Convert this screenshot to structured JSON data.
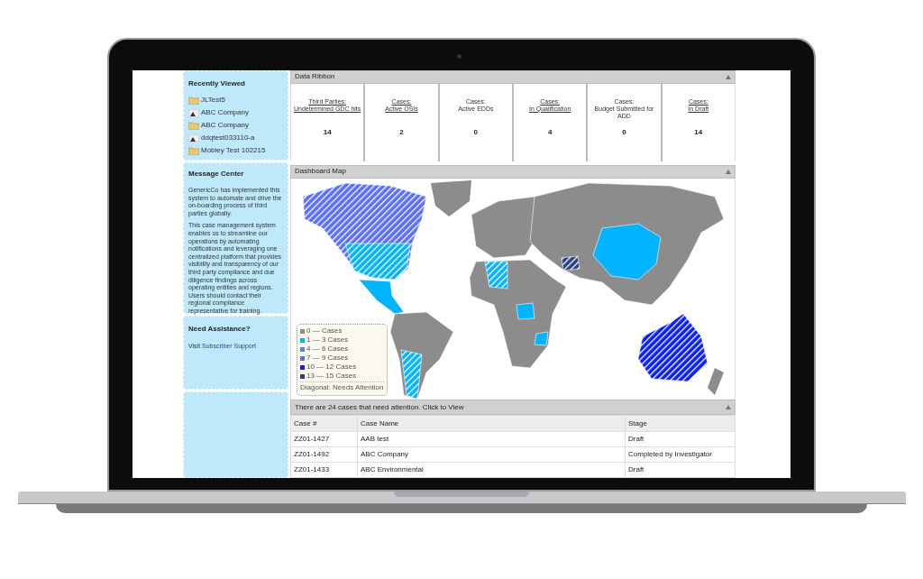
{
  "sidebar": {
    "recently_viewed": {
      "title": "Recently Viewed",
      "items": [
        {
          "kind": "folder",
          "label": "JLTest5"
        },
        {
          "kind": "entity",
          "label": "ABC Company"
        },
        {
          "kind": "folder",
          "label": "ABC Company"
        },
        {
          "kind": "entity",
          "label": "ddqtest033110-a"
        },
        {
          "kind": "folder",
          "label": "Mobley Test 102215"
        }
      ]
    },
    "message_center": {
      "title": "Message Center",
      "paragraphs": [
        "GenericCo has implemented this system to automate and drive the on-boarding process of third parties globally.",
        "This case management system enables us to streamline our operations by automating notifications and leveraging one centralized platform that provides visibility and transparency of our third party compliance and due diligence findings across operating entities and regions.\nUsers should contact their regional compliance representative for training."
      ]
    },
    "need_assistance": {
      "title": "Need Assistance?",
      "prefix": "Visit",
      "link": "Subscriber Support"
    }
  },
  "data_ribbon": {
    "title": "Data Ribbon",
    "cells": [
      {
        "label": "Third Parties:\nUndetermined GDC hits",
        "link": true,
        "value": "14"
      },
      {
        "label": "Cases:\nActive OSIs",
        "link": true,
        "value": "2"
      },
      {
        "label": "Cases:\nActive EDDs",
        "link": false,
        "value": "0"
      },
      {
        "label": "Cases:\nIn Qualification",
        "link": true,
        "value": "4"
      },
      {
        "label": "Cases:\nBudget Submitted for ADD",
        "link": false,
        "value": "0"
      },
      {
        "label": "Cases:\nIn Draft",
        "link": true,
        "value": "14"
      }
    ]
  },
  "dashboard_map": {
    "title": "Dashboard Map",
    "legend": [
      {
        "label": "0 — Cases",
        "color": "#8c8c8c"
      },
      {
        "label": "1 — 3 Cases",
        "color": "#00b4ff"
      },
      {
        "label": "4 — 6 Cases",
        "color": "#3c8cff"
      },
      {
        "label": "7 — 9 Cases",
        "color": "#5a6eff"
      },
      {
        "label": "10 — 12 Cases",
        "color": "#0a1eff"
      },
      {
        "label": "13 — 15 Cases",
        "color": "#2a3f8a"
      }
    ],
    "legend_note": "Diagonal: Needs Attention"
  },
  "cases": {
    "title": "There are 24 cases that need attention. Click to View",
    "columns": [
      "Case #",
      "Case Name",
      "Stage"
    ],
    "rows": [
      [
        "ZZ01-1427",
        "AAB test",
        "Draft"
      ],
      [
        "ZZ01-1492",
        "ABC Company",
        "Completed by Investigator"
      ],
      [
        "ZZ01-1433",
        "ABC Environmental",
        "Draft"
      ]
    ]
  }
}
